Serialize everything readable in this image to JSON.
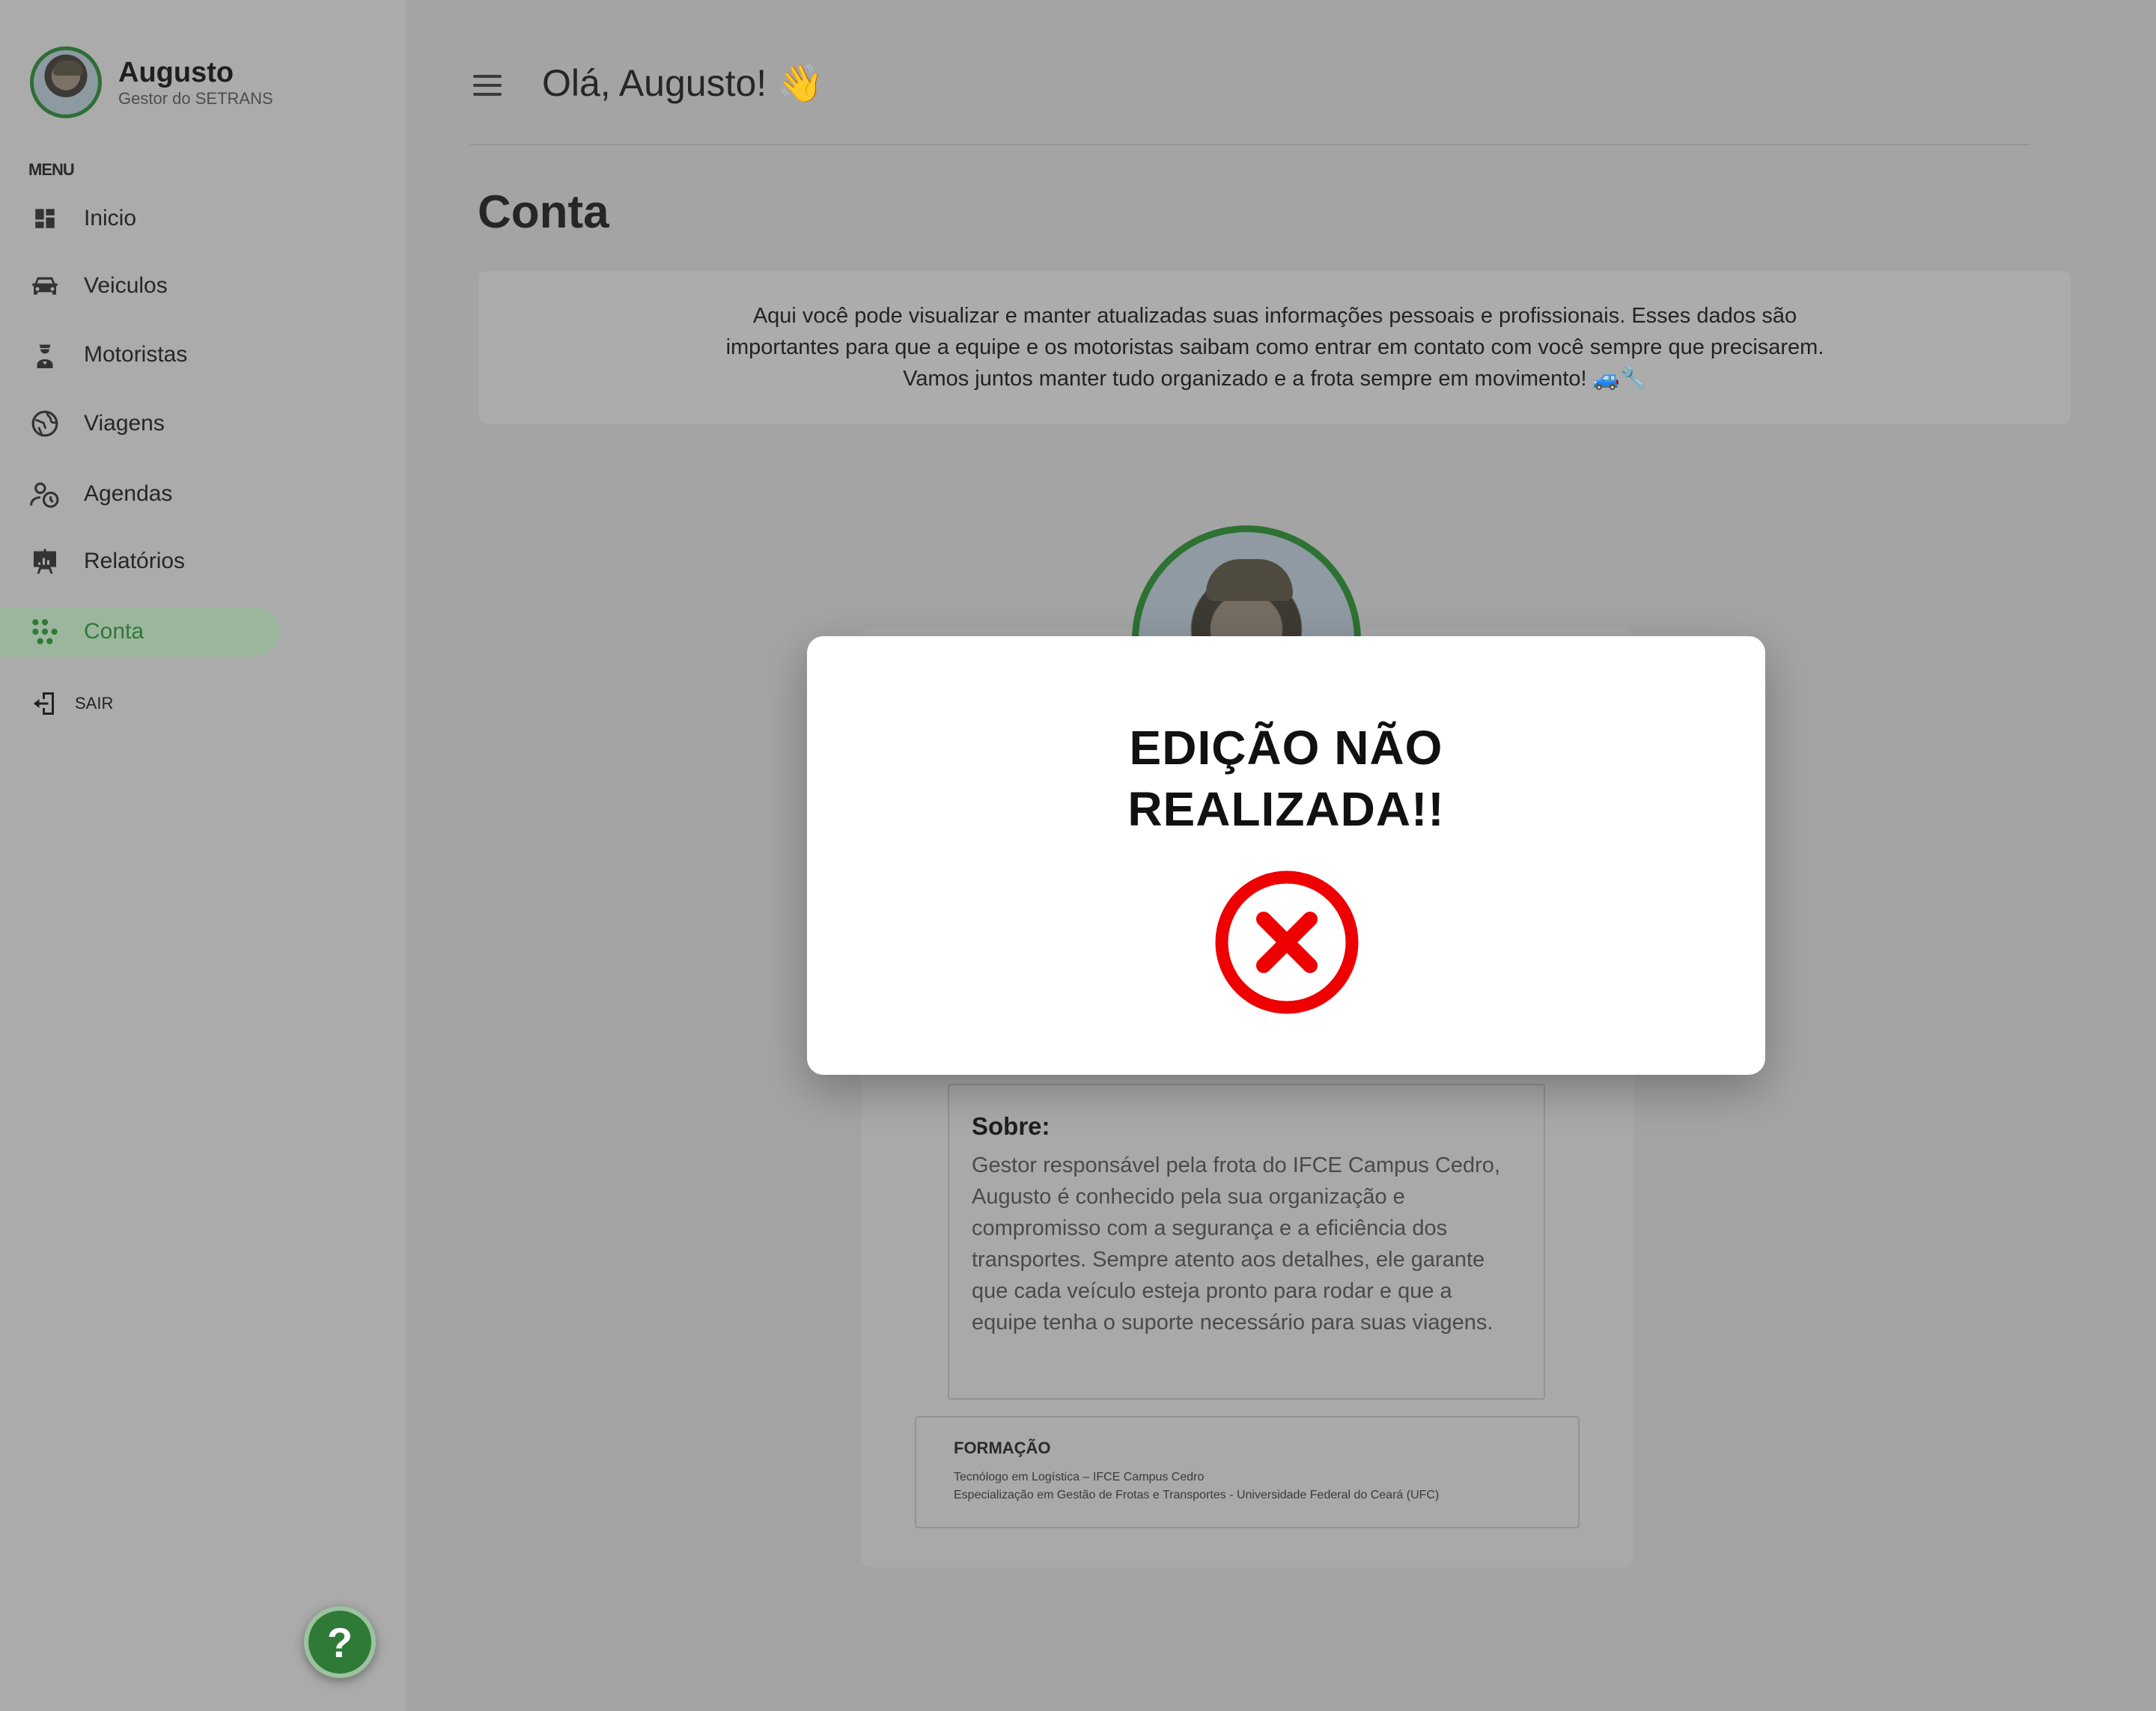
{
  "user": {
    "name": "Augusto",
    "role": "Gestor do SETRANS"
  },
  "sidebar": {
    "menu_caption": "MENU",
    "items": [
      {
        "label": "Inicio",
        "icon": "dashboard-icon"
      },
      {
        "label": "Veiculos",
        "icon": "car-icon"
      },
      {
        "label": "Motoristas",
        "icon": "driver-icon"
      },
      {
        "label": "Viagens",
        "icon": "globe-icon"
      },
      {
        "label": "Agendas",
        "icon": "user-clock-icon"
      },
      {
        "label": "Relatórios",
        "icon": "report-board-icon"
      },
      {
        "label": "Conta",
        "icon": "account-dots-icon",
        "active": true
      }
    ],
    "logout_label": "SAIR",
    "help_label": "?"
  },
  "header": {
    "greeting": "Olá, Augusto! 👋"
  },
  "page": {
    "title": "Conta",
    "intro": "Aqui você pode visualizar e manter atualizadas suas informações pessoais e profissionais. Esses dados são importantes para que a equipe e os motoristas saibam como entrar em contato com você sempre que precisarem. Vamos juntos manter tudo organizado e a frota sempre em movimento! 🚙🔧"
  },
  "account": {
    "about_title": "Sobre:",
    "about_body": "Gestor responsável pela frota do IFCE Campus Cedro, Augusto é conhecido pela sua organização e compromisso com a segurança e a eficiência dos transportes. Sempre atento aos detalhes, ele garante que cada veículo esteja pronto para rodar e que a equipe tenha o suporte necessário para suas viagens.",
    "education_title": "FORMAÇÃO",
    "education": [
      "Tecnólogo em Logística – IFCE Campus Cedro",
      "Especialização em Gestão de Frotas e Transportes - Universidade Federal do Ceará (UFC)"
    ]
  },
  "modal": {
    "title_line1": "EDIÇÃO NÃO",
    "title_line2": "REALIZADA!!",
    "icon": "error-x-icon"
  },
  "colors": {
    "accent_green": "#2f7a37",
    "error_red": "#ee0000"
  }
}
